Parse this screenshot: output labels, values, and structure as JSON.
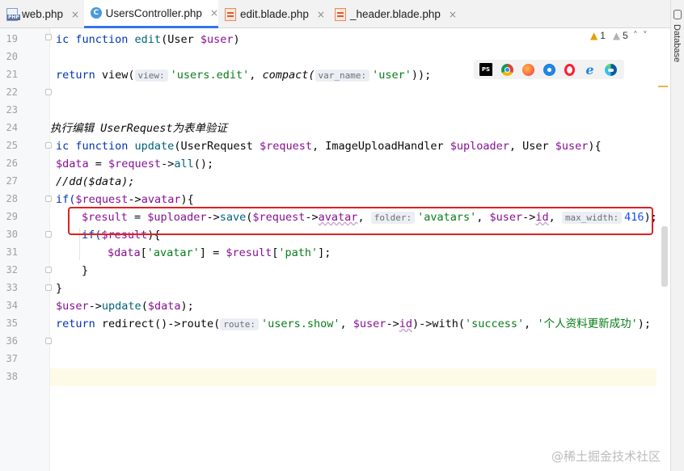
{
  "tabs": [
    {
      "label": "web.php",
      "icon": "php-file-icon",
      "active": false
    },
    {
      "label": "UsersController.php",
      "icon": "php-class-icon",
      "active": true
    },
    {
      "label": "edit.blade.php",
      "icon": "blade-file-icon",
      "active": false
    },
    {
      "label": "_header.blade.php",
      "icon": "blade-file-icon",
      "active": false
    }
  ],
  "tab_close_glyph": "×",
  "php_badge": "PHP",
  "class_badge": "C",
  "right_panel": {
    "label": "Database"
  },
  "inspections": {
    "warnings": "1",
    "weak_warnings": "5",
    "warn_glyph": "▲",
    "weak_glyph": "▲",
    "up": "˄",
    "down": "˅"
  },
  "browsers": {
    "phpstorm_badge": "PS",
    "items": [
      "phpstorm-icon",
      "chrome-icon",
      "firefox-icon",
      "safari-icon",
      "opera-icon",
      "ie-icon",
      "edge-icon"
    ],
    "ie_glyph": "e"
  },
  "code": {
    "l19": {
      "n": "19",
      "a": "ic function ",
      "b": "edit",
      "c": "(User ",
      "d": "$user",
      "e": ")"
    },
    "l20": {
      "n": "20"
    },
    "l21": {
      "n": "21",
      "a": "return ",
      "b": "view(",
      "h1": "view:",
      "s1": "'users.edit'",
      "c": ", ",
      "d": "compact(",
      "h2": "var_name:",
      "s2": "'user'",
      "e": "));"
    },
    "l22": {
      "n": "22"
    },
    "l23": {
      "n": "23"
    },
    "l24": {
      "n": "24",
      "comment": "执行编辑 UserRequest为表单验证"
    },
    "l25": {
      "n": "25",
      "a": "ic function ",
      "b": "update",
      "c": "(UserRequest ",
      "d": "$request",
      "e": ", ImageUploadHandler ",
      "f": "$uploader",
      "g": ", User ",
      "h": "$user",
      "i": "){"
    },
    "l26": {
      "n": "26",
      "a": "$data",
      "b": " = ",
      "c": "$request",
      "d": "->",
      "e": "all",
      "f": "();"
    },
    "l27": {
      "n": "27",
      "comment": "//dd($data);"
    },
    "l28": {
      "n": "28",
      "a": "if(",
      "b": "$request",
      "c": "->",
      "d": "avatar",
      "e": "){"
    },
    "l29": {
      "n": "29",
      "a": "$result",
      "b": " = ",
      "c": "$uploader",
      "d": "->",
      "e": "save",
      "f": "(",
      "g": "$request",
      "h": "->",
      "i": "avatar",
      "j": ", ",
      "h1": "folder:",
      "s1": "'avatars'",
      "k": ", ",
      "l": "$user",
      "m": "->",
      "o": "id",
      "p": ", ",
      "h2": "max_width:",
      "num": "416",
      "q": ");"
    },
    "l30": {
      "n": "30",
      "a": "if(",
      "b": "$result",
      "c": "){"
    },
    "l31": {
      "n": "31",
      "a": "$data",
      "b": "[",
      "s1": "'avatar'",
      "c": "] = ",
      "d": "$result",
      "e": "[",
      "s2": "'path'",
      "f": "];"
    },
    "l32": {
      "n": "32",
      "a": "}"
    },
    "l33": {
      "n": "33",
      "a": "}"
    },
    "l34": {
      "n": "34",
      "a": "$user",
      "b": "->",
      "c": "update",
      "d": "(",
      "e": "$data",
      "f": ");"
    },
    "l35": {
      "n": "35",
      "a": "return ",
      "b": "redirect",
      "c": "()->",
      "d": "route",
      "e": "(",
      "h1": "route:",
      "s1": "'users.show'",
      "f": ", ",
      "g": "$user",
      "h": "->",
      "i": "id",
      "j": ")->",
      "k": "with",
      "l": "(",
      "s2": "'success'",
      "m": ", ",
      "s3": "'个人资料更新成功'",
      "o": ");"
    },
    "l36": {
      "n": "36"
    },
    "l37": {
      "n": "37"
    },
    "l38": {
      "n": "38"
    }
  },
  "watermark": "@稀土掘金技术社区"
}
